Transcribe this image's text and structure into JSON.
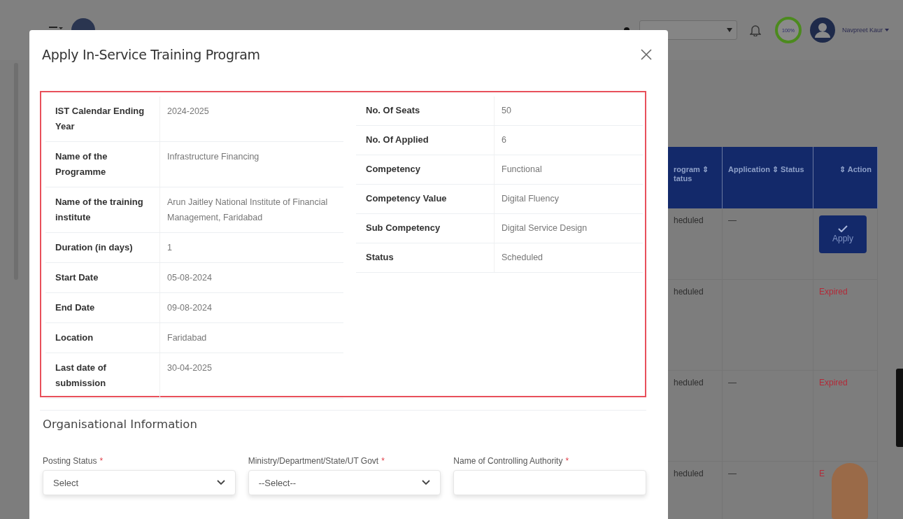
{
  "topbar": {
    "progress_label": "100%",
    "user_name": "Navpreet Kaur"
  },
  "background_table": {
    "columns": [
      "rogram ⇕ tatus",
      "Application ⇕ Status",
      "⇕ Action"
    ],
    "rows": [
      {
        "program_status": "heduled",
        "application_status": "—",
        "action": {
          "kind": "button",
          "label": "Apply"
        }
      },
      {
        "program_status": "heduled",
        "application_status": "",
        "action": {
          "kind": "expired",
          "label": "Expired"
        }
      },
      {
        "program_status": "heduled",
        "application_status": "—",
        "action": {
          "kind": "expired",
          "label": "Expired"
        }
      },
      {
        "program_status": "heduled",
        "application_status": "—",
        "action": {
          "kind": "expired",
          "label": "E"
        }
      }
    ]
  },
  "modal": {
    "title": "Apply In-Service Training Program",
    "details_left": [
      {
        "label": "IST Calendar Ending Year",
        "value": "2024-2025"
      },
      {
        "label": "Name of the Programme",
        "value": "Infrastructure Financing"
      },
      {
        "label": "Name of the training institute",
        "value": "Arun Jaitley National Institute of Financial Management, Faridabad"
      },
      {
        "label": "Duration (in days)",
        "value": "1"
      },
      {
        "label": "Start Date",
        "value": "05-08-2024"
      },
      {
        "label": "End Date",
        "value": "09-08-2024"
      },
      {
        "label": "Location",
        "value": "Faridabad"
      },
      {
        "label": "Last date of submission",
        "value": "30-04-2025"
      }
    ],
    "details_right": [
      {
        "label": "No. Of Seats",
        "value": "50"
      },
      {
        "label": "No. Of Applied",
        "value": "6"
      },
      {
        "label": "Competency",
        "value": "Functional"
      },
      {
        "label": "Competency Value",
        "value": "Digital Fluency"
      },
      {
        "label": "Sub Competency",
        "value": "Digital Service Design"
      },
      {
        "label": "Status",
        "value": "Scheduled"
      }
    ],
    "section_title": "Organisational Information",
    "fields": [
      {
        "label": "Posting Status",
        "required_mark": "*",
        "kind": "select",
        "value": "Select"
      },
      {
        "label": "Ministry/Department/State/UT Govt",
        "required_mark": "*",
        "kind": "select",
        "value": "--Select--"
      },
      {
        "label": "Name of Controlling Authority",
        "required_mark": "*",
        "kind": "text"
      }
    ]
  }
}
